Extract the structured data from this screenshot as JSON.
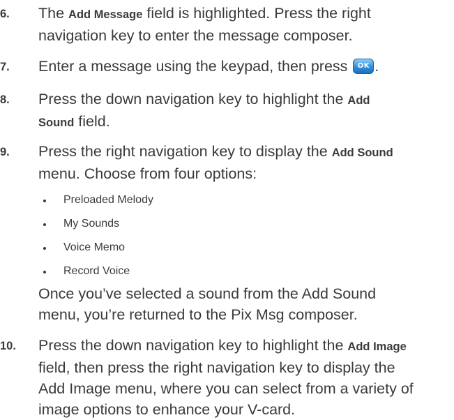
{
  "steps": [
    {
      "num": "6.",
      "l1a": "The ",
      "b1": "Add Message",
      "l1b": " field is highlighted. Press the right",
      "l2": "navigation key to enter the message composer."
    },
    {
      "num": "7.",
      "l1a": "Enter a message using the keypad, then press ",
      "ok_key_label": "OK",
      "l1b": "."
    },
    {
      "num": "8.",
      "l1a": "Press the down navigation key to highlight the ",
      "b1": "Add",
      "b2": "Sound",
      "l2b": " field."
    },
    {
      "num": "9.",
      "l1a": "Press the right navigation key to display the ",
      "b1": "Add Sound",
      "l2": "menu. Choose from four options:",
      "options": [
        "Preloaded Melody",
        "My Sounds",
        "Voice Memo",
        "Record Voice"
      ],
      "note_l1": "Once you’ve selected a sound from the Add Sound",
      "note_l2": "menu, you’re returned to the Pix Msg composer."
    },
    {
      "num": "10.",
      "l1a": "Press the down navigation key to highlight the ",
      "b1": "Add Image",
      "l2": "field, then press the right navigation key to display the",
      "l3": "Add Image menu, where you can select from a variety of",
      "l4": "image options to enhance your V-card."
    }
  ]
}
